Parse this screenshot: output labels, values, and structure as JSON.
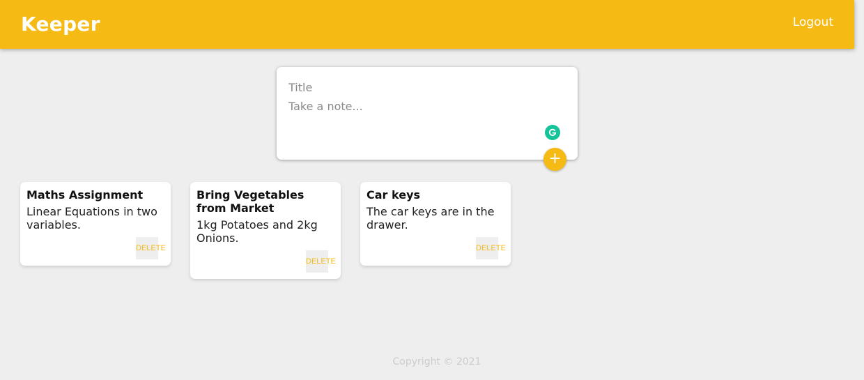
{
  "header": {
    "brand": "Keeper",
    "logout_label": "Logout"
  },
  "composer": {
    "title_placeholder": "Title",
    "content_placeholder": "Take a note...",
    "add_button_label": "+"
  },
  "notes": [
    {
      "title": "Maths Assignment",
      "content": "Linear Equations in two variables.",
      "delete_label": "DELETE"
    },
    {
      "title": "Bring Vegetables from Market",
      "content": "1kg Potatoes and 2kg Onions.",
      "delete_label": "DELETE"
    },
    {
      "title": "Car keys",
      "content": "The car keys are in the drawer.",
      "delete_label": "DELETE"
    }
  ],
  "footer": {
    "copyright": "Copyright © 2021"
  },
  "colors": {
    "accent": "#f5ba13",
    "background": "#eeeeee",
    "grammarly": "#15c39a"
  },
  "icons": {
    "grammarly": "grammarly-icon",
    "add": "plus-icon"
  }
}
